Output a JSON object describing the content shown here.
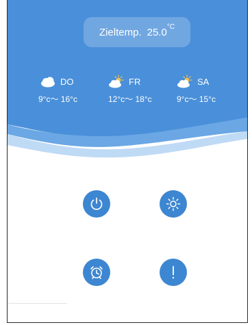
{
  "target": {
    "label": "Zieltemp.",
    "value": "25.0",
    "unit": "°C"
  },
  "forecast": [
    {
      "day": "DO",
      "icon": "cloud-icon",
      "range": "9°c～ 16°c"
    },
    {
      "day": "FR",
      "icon": "partly-sunny-icon",
      "range": "12°c～ 18°c"
    },
    {
      "day": "SA",
      "icon": "partly-sunny-icon",
      "range": "9°c～ 15°c"
    }
  ],
  "controls": [
    {
      "name": "power",
      "icon": "power-icon"
    },
    {
      "name": "brightness",
      "icon": "sun-icon"
    },
    {
      "name": "alarm",
      "icon": "alarm-clock-icon"
    },
    {
      "name": "alert",
      "icon": "exclamation-icon"
    }
  ],
  "colors": {
    "header_blue": "#4a8fd9",
    "button_blue": "#3d86d1",
    "wave_light": "#7fb6ea",
    "text": "#ffffff"
  }
}
